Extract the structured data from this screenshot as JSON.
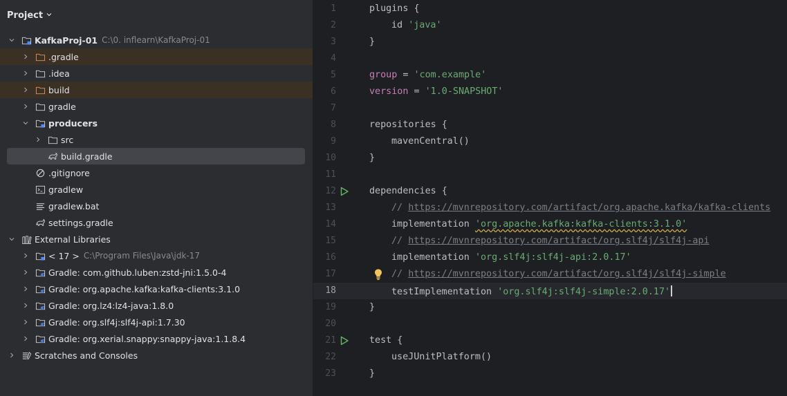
{
  "panel": {
    "title": "Project"
  },
  "tree": {
    "root": {
      "label": "KafkaProj-01",
      "path": "C:\\0. inflearn\\KafkaProj-01"
    },
    "gradle_dir": ".gradle",
    "idea_dir": ".idea",
    "build_dir": "build",
    "gradle": "gradle",
    "producers": "producers",
    "src": "src",
    "build_gradle": "build.gradle",
    "gitignore": ".gitignore",
    "gradlew": "gradlew",
    "gradlew_bat": "gradlew.bat",
    "settings_gradle": "settings.gradle",
    "external_libraries": "External Libraries",
    "jdk": {
      "label": "< 17 >",
      "path": "C:\\Program Files\\Java\\jdk-17"
    },
    "libs": [
      "Gradle: com.github.luben:zstd-jni:1.5.0-4",
      "Gradle: org.apache.kafka:kafka-clients:3.1.0",
      "Gradle: org.lz4:lz4-java:1.8.0",
      "Gradle: org.slf4j:slf4j-api:1.7.30",
      "Gradle: org.xerial.snappy:snappy-java:1.1.8.4"
    ],
    "scratches": "Scratches and Consoles"
  },
  "editor": {
    "line_numbers": [
      "1",
      "2",
      "3",
      "4",
      "5",
      "6",
      "7",
      "8",
      "9",
      "10",
      "11",
      "12",
      "13",
      "14",
      "15",
      "16",
      "17",
      "18",
      "19",
      "20",
      "21",
      "22",
      "23"
    ],
    "code": {
      "l1": "plugins {",
      "l2_id": "id ",
      "l2_str": "'java'",
      "l3": "}",
      "l5_kw": "group",
      "l5_eq": " = ",
      "l5_str": "'com.example'",
      "l6_kw": "version",
      "l6_eq": " = ",
      "l6_str": "'1.0-SNAPSHOT'",
      "l8": "repositories {",
      "l9": "mavenCentral()",
      "l10": "}",
      "l12": "dependencies {",
      "comment_prefix": "// ",
      "l13_url": "https://mvnrepository.com/artifact/org.apache.kafka/kafka-clients",
      "impl": "implementation ",
      "l14_str": "'org.apache.kafka:kafka-clients:3.1.0'",
      "l15_url": "https://mvnrepository.com/artifact/org.slf4j/slf4j-api",
      "l16_str": "'org.slf4j:slf4j-api:2.0.17'",
      "l17_url": "https://mvnrepository.com/artifact/org.slf4j/slf4j-simple",
      "test_impl": "testImplementation ",
      "l18_str": "'org.slf4j:slf4j-simple:2.0.17'",
      "l19": "}",
      "l21": "test {",
      "l22": "useJUnitPlatform()",
      "l23": "}"
    }
  }
}
